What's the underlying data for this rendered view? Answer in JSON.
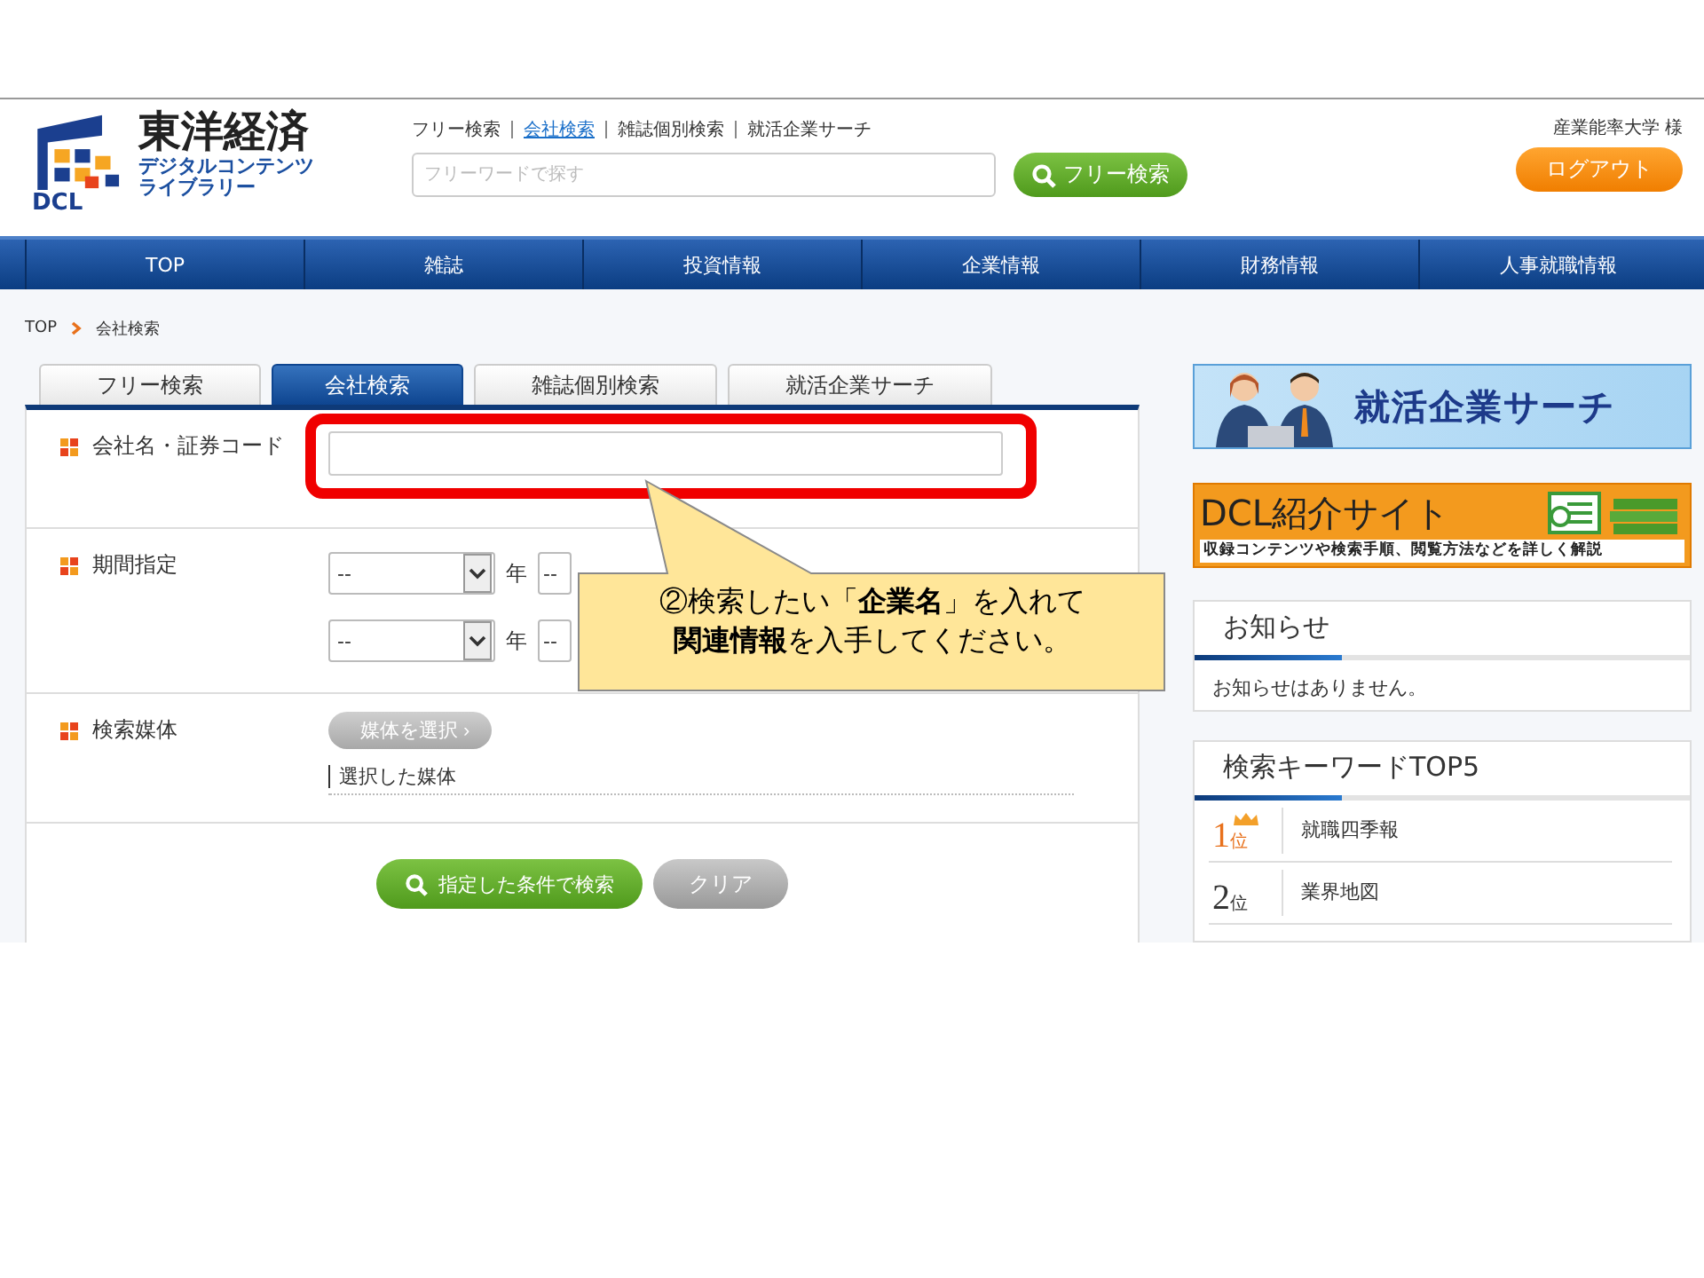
{
  "header": {
    "logo": {
      "mark": "DCL",
      "title": "東洋経済",
      "subtitle_1": "デジタルコンテンツ",
      "subtitle_2": "ライブラリー"
    },
    "links": [
      {
        "label": "フリー検索",
        "selected": false
      },
      {
        "label": "会社検索",
        "selected": true
      },
      {
        "label": "雑誌個別検索",
        "selected": false
      },
      {
        "label": "就活企業サーチ",
        "selected": false
      }
    ],
    "search": {
      "placeholder": "フリーワードで探す",
      "button": "フリー検索"
    },
    "user": "産業能率大学 様",
    "logout": "ログアウト"
  },
  "nav": [
    "TOP",
    "雑誌",
    "投資情報",
    "企業情報",
    "財務情報",
    "人事就職情報"
  ],
  "breadcrumb": [
    "TOP",
    "会社検索"
  ],
  "tabs": [
    {
      "label": "フリー検索",
      "selected": false
    },
    {
      "label": "会社検索",
      "selected": true
    },
    {
      "label": "雑誌個別検索",
      "selected": false
    },
    {
      "label": "就活企業サーチ",
      "selected": false
    }
  ],
  "form": {
    "rows": [
      {
        "kind": "text",
        "label": "会社名・証券コード"
      },
      {
        "kind": "period",
        "label": "期間指定",
        "ranges": [
          {
            "year": "--",
            "year_unit": "年",
            "month": "--"
          },
          {
            "year": "--",
            "year_unit": "年",
            "month": "--"
          }
        ]
      },
      {
        "kind": "media",
        "label": "検索媒体",
        "button": "媒体を選択 ›",
        "selected_text": "選択した媒体"
      }
    ],
    "buttons": [
      {
        "kind": "primary",
        "label": "指定した条件で検索"
      },
      {
        "kind": "secondary",
        "label": "クリア"
      }
    ]
  },
  "banners": [
    {
      "kind": "job",
      "title": "就活企業サーチ"
    },
    {
      "kind": "intro",
      "title": "DCL紹介サイト",
      "subtitle": "収録コンテンツや検索手順、閲覧方法などを詳しく解説"
    }
  ],
  "notice": {
    "title": "お知らせ",
    "message": "お知らせはありません。"
  },
  "keywords": {
    "title": "検索キーワードTOP5",
    "items": [
      {
        "number": "1",
        "suffix": "位",
        "top": true,
        "keyword": "就職四季報"
      },
      {
        "number": "2",
        "suffix": "位",
        "top": false,
        "keyword": "業界地図"
      }
    ]
  },
  "callout": {
    "lines": [
      "②検索したい「**企業名**」を入れて",
      "**関連情報**を入手してください。"
    ]
  }
}
